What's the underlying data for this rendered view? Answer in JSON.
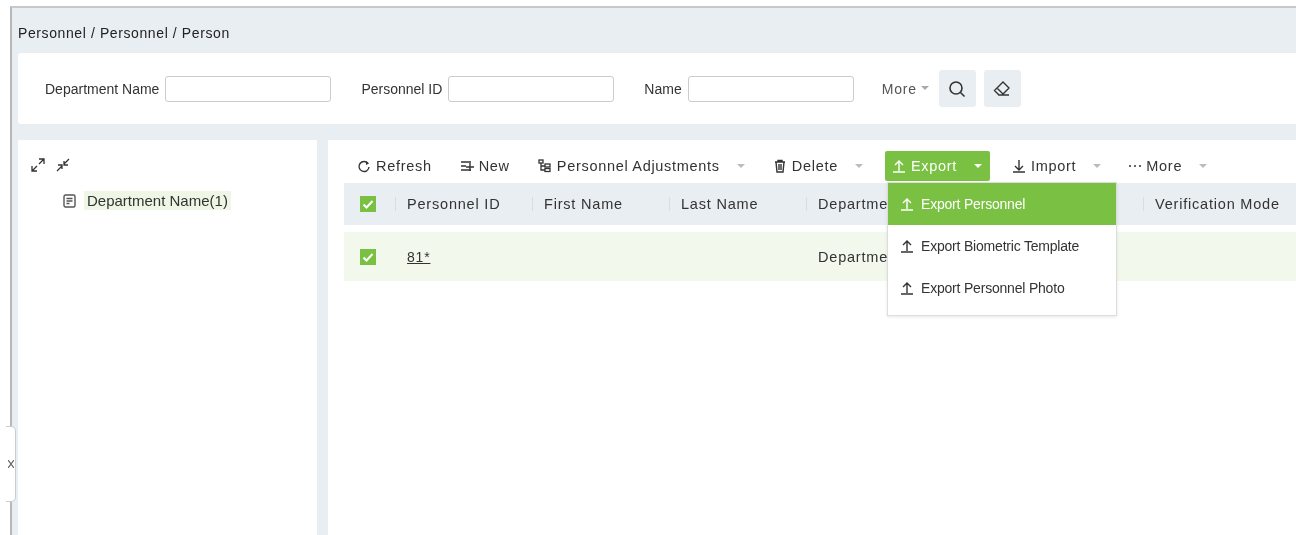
{
  "breadcrumb": "Personnel / Personnel / Person",
  "filters": [
    {
      "label": "Department Name"
    },
    {
      "label": "Personnel ID"
    },
    {
      "label": "Name"
    }
  ],
  "filter_more": "More",
  "tree": {
    "items": [
      {
        "label": "Department Name(1)",
        "selected": true
      }
    ]
  },
  "toolbar": [
    {
      "label": "Refresh",
      "kind": "refresh",
      "caret": false,
      "selected": false
    },
    {
      "label": "New",
      "kind": "new",
      "caret": false,
      "selected": false
    },
    {
      "label": "Personnel Adjustments",
      "kind": "adjust",
      "caret": true,
      "selected": false
    },
    {
      "label": "Delete",
      "kind": "delete",
      "caret": true,
      "selected": false
    },
    {
      "label": "Export",
      "kind": "export",
      "caret": true,
      "selected": true
    },
    {
      "label": "Import",
      "kind": "import",
      "caret": true,
      "selected": false
    },
    {
      "label": "More",
      "kind": "more",
      "caret": true,
      "selected": false
    }
  ],
  "export_menu": [
    {
      "label": "Export Personnel",
      "selected": true
    },
    {
      "label": "Export Biometric Template",
      "selected": false
    },
    {
      "label": "Export Personnel Photo",
      "selected": false
    }
  ],
  "table": {
    "header_checked": true,
    "columns": [
      "Personnel ID",
      "First Name",
      "Last Name",
      "Departme",
      "Verification Mode"
    ],
    "rows": [
      {
        "checked": true,
        "selected": true,
        "cells": [
          "81*",
          "",
          "",
          "Departme",
          ""
        ]
      }
    ]
  }
}
